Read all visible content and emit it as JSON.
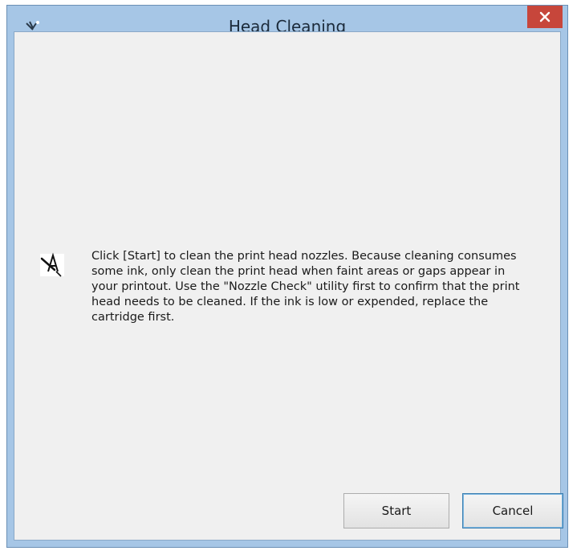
{
  "window": {
    "title": "Head Cleaning",
    "close_icon": "close-icon",
    "app_icon": "printer-head-icon"
  },
  "dialog": {
    "message": "Click [Start] to clean the print head nozzles. Because cleaning consumes some ink, only clean the print head when faint areas or gaps appear in your printout. Use the \"Nozzle Check\" utility first to confirm that the print head needs to be cleaned. If the ink is low or expended, replace the cartridge first.",
    "message_icon": "print-head-cleaning-icon"
  },
  "buttons": {
    "start_label": "Start",
    "cancel_label": "Cancel"
  },
  "colors": {
    "frame": "#a6c6e6",
    "close_button": "#c7463b",
    "client_bg": "#f0f0f0",
    "default_button_border": "#3c7fb1"
  }
}
